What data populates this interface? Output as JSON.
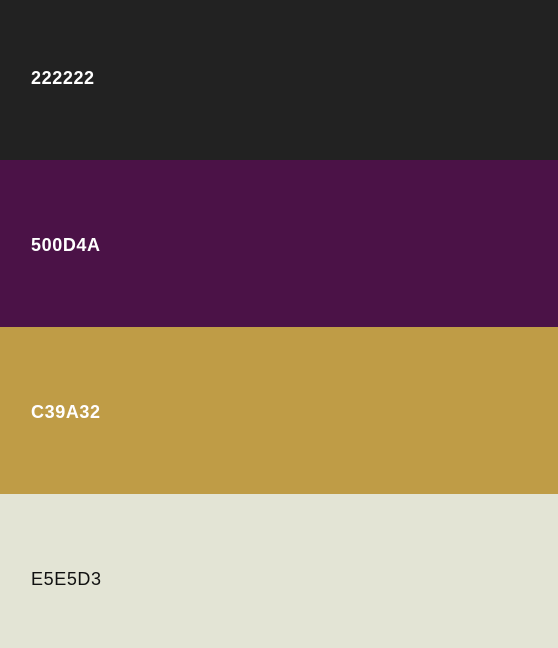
{
  "palette": {
    "swatches": [
      {
        "hex": "222222",
        "color": "#222222",
        "text_color": "#FFFFFF"
      },
      {
        "hex": "500D4A",
        "color": "#4B1247",
        "text_color": "#FFFFFF"
      },
      {
        "hex": "C39A32",
        "color": "#BF9C46",
        "text_color": "#FFFFFF"
      },
      {
        "hex": "E5E5D3",
        "color": "#E3E4D5",
        "text_color": "#111111"
      }
    ]
  }
}
